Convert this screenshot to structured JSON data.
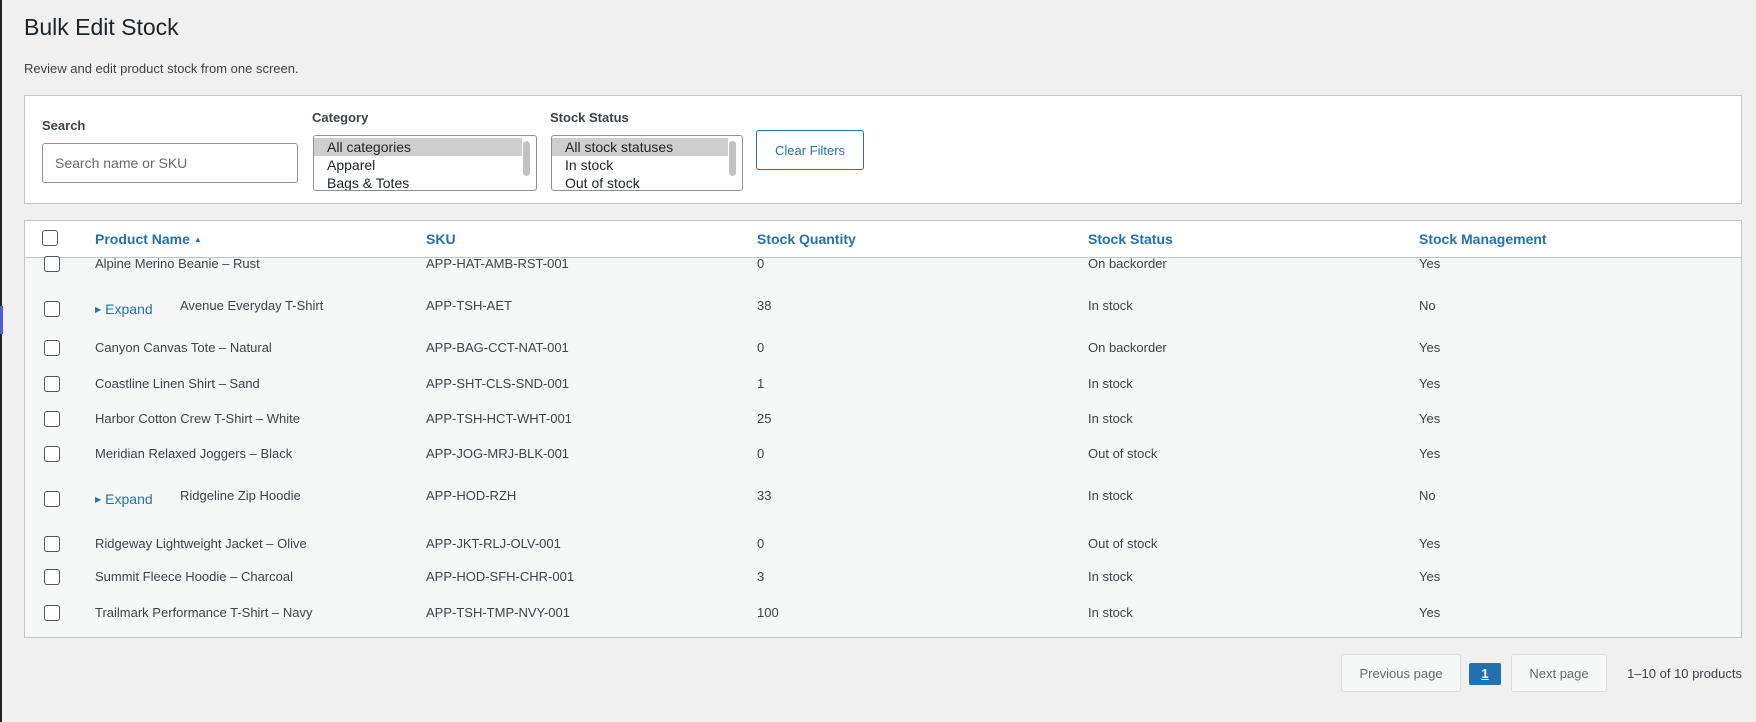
{
  "page": {
    "title": "Bulk Edit Stock",
    "description": "Review and edit product stock from one screen."
  },
  "filters": {
    "search_label": "Search",
    "search_placeholder": "Search name or SKU",
    "search_value": "",
    "category_label": "Category",
    "category_options": [
      "All categories",
      "Apparel",
      "Bags & Totes"
    ],
    "category_selected": "All categories",
    "status_label": "Stock Status",
    "status_options": [
      "All stock statuses",
      "In stock",
      "Out of stock"
    ],
    "status_selected": "All stock statuses",
    "clear_label": "Clear Filters"
  },
  "table": {
    "columns": {
      "name": "Product Name",
      "sku": "SKU",
      "qty": "Stock Quantity",
      "status": "Stock Status",
      "manage": "Stock Management"
    },
    "sort_indicator": "▲",
    "expand_label": "Expand",
    "rows": [
      {
        "name": "Alpine Merino Beanie – Rust",
        "sku": "APP-HAT-AMB-RST-001",
        "qty": "0",
        "status": "On backorder",
        "manage": "Yes",
        "expandable": false
      },
      {
        "name": "Avenue Everyday T-Shirt",
        "sku": "APP-TSH-AET",
        "qty": "38",
        "status": "In stock",
        "manage": "No",
        "expandable": true
      },
      {
        "name": "Canyon Canvas Tote – Natural",
        "sku": "APP-BAG-CCT-NAT-001",
        "qty": "0",
        "status": "On backorder",
        "manage": "Yes",
        "expandable": false
      },
      {
        "name": "Coastline Linen Shirt – Sand",
        "sku": "APP-SHT-CLS-SND-001",
        "qty": "1",
        "status": "In stock",
        "manage": "Yes",
        "expandable": false
      },
      {
        "name": "Harbor Cotton Crew T-Shirt – White",
        "sku": "APP-TSH-HCT-WHT-001",
        "qty": "25",
        "status": "In stock",
        "manage": "Yes",
        "expandable": false
      },
      {
        "name": "Meridian Relaxed Joggers – Black",
        "sku": "APP-JOG-MRJ-BLK-001",
        "qty": "0",
        "status": "Out of stock",
        "manage": "Yes",
        "expandable": false
      },
      {
        "name": "Ridgeline Zip Hoodie",
        "sku": "APP-HOD-RZH",
        "qty": "33",
        "status": "In stock",
        "manage": "No",
        "expandable": true
      },
      {
        "name": "Ridgeway Lightweight Jacket – Olive",
        "sku": "APP-JKT-RLJ-OLV-001",
        "qty": "0",
        "status": "Out of stock",
        "manage": "Yes",
        "expandable": false
      },
      {
        "name": "Summit Fleece Hoodie – Charcoal",
        "sku": "APP-HOD-SFH-CHR-001",
        "qty": "3",
        "status": "In stock",
        "manage": "Yes",
        "expandable": false
      },
      {
        "name": "Trailmark Performance T-Shirt – Navy",
        "sku": "APP-TSH-TMP-NVY-001",
        "qty": "100",
        "status": "In stock",
        "manage": "Yes",
        "expandable": false
      }
    ]
  },
  "pagination": {
    "prev_label": "Previous page",
    "current_page": "1",
    "next_label": "Next page",
    "info": "1–10 of 10 products"
  },
  "colors": {
    "accent": "#2271b1",
    "background": "#f0f0f1",
    "panel": "#ffffff",
    "border": "#c3c4c7"
  }
}
